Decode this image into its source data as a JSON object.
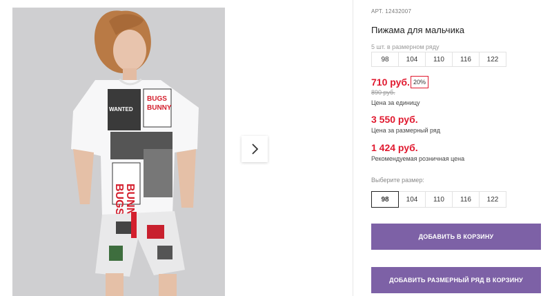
{
  "product": {
    "article_label": "АРТ.",
    "article": "12432007",
    "title": "Пижама для мальчика",
    "row_label": "5 шт. в размерном ряду",
    "row_sizes": [
      "98",
      "104",
      "110",
      "116",
      "122"
    ]
  },
  "pricing": {
    "unit_price": "710 руб.",
    "discount_badge": "20%",
    "old_price": "890 руб.",
    "unit_caption": "Цена за единицу",
    "row_price": "3 550 руб.",
    "row_caption": "Цена за размерный ряд",
    "retail_price": "1 424 руб.",
    "retail_caption": "Рекомендуемая розничная цена"
  },
  "size_select": {
    "label": "Выберите размер:",
    "sizes": [
      "98",
      "104",
      "110",
      "116",
      "122"
    ],
    "selected": "98"
  },
  "actions": {
    "add_to_cart": "ДОБАВИТЬ В КОРЗИНУ",
    "add_row_to_cart": "ДОБАВИТЬ РАЗМЕРНЫЙ РЯД В КОРЗИНУ"
  },
  "image_print_text": [
    "BUGS",
    "BUNNY",
    "WANTED",
    "BUGS",
    "BUNNY"
  ],
  "colors": {
    "accent_red": "#e0182e",
    "button_purple": "#7d61a6",
    "gallery_bg": "#cfcfd1"
  },
  "icons": {
    "next": "chevron-right-icon"
  }
}
